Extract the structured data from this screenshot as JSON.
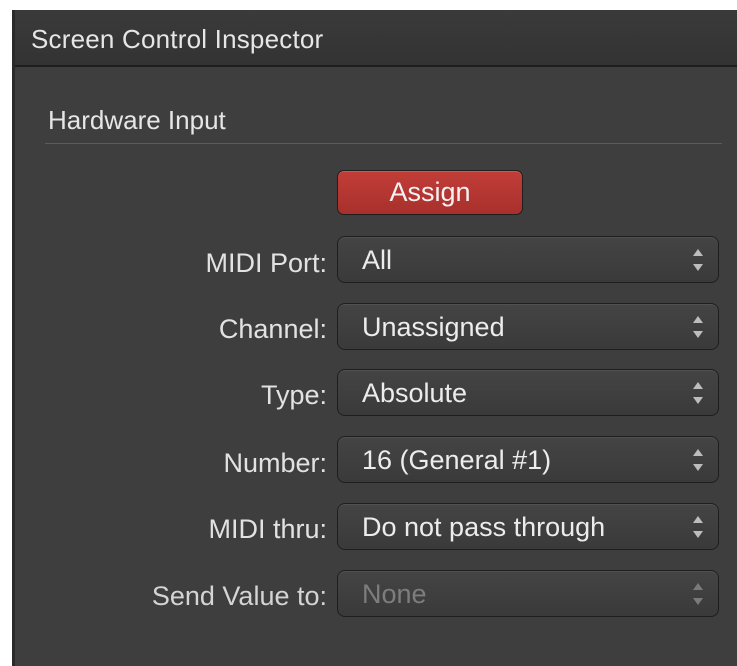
{
  "window": {
    "title": "Screen Control Inspector"
  },
  "section": {
    "title": "Hardware Input"
  },
  "assign": {
    "label": "Assign",
    "color": "#b8332f"
  },
  "rows": [
    {
      "label": "MIDI Port:",
      "value": "All"
    },
    {
      "label": "Channel:",
      "value": "Unassigned"
    },
    {
      "label": "Type:",
      "value": "Absolute"
    },
    {
      "label": "Number:",
      "value": "16 (General #1)"
    },
    {
      "label": "MIDI thru:",
      "value": "Do not pass through"
    },
    {
      "label": "Send Value to:",
      "value": "None",
      "disabled": true
    }
  ],
  "icons": {
    "popup_arrows": "up-down-chevrons-icon"
  }
}
